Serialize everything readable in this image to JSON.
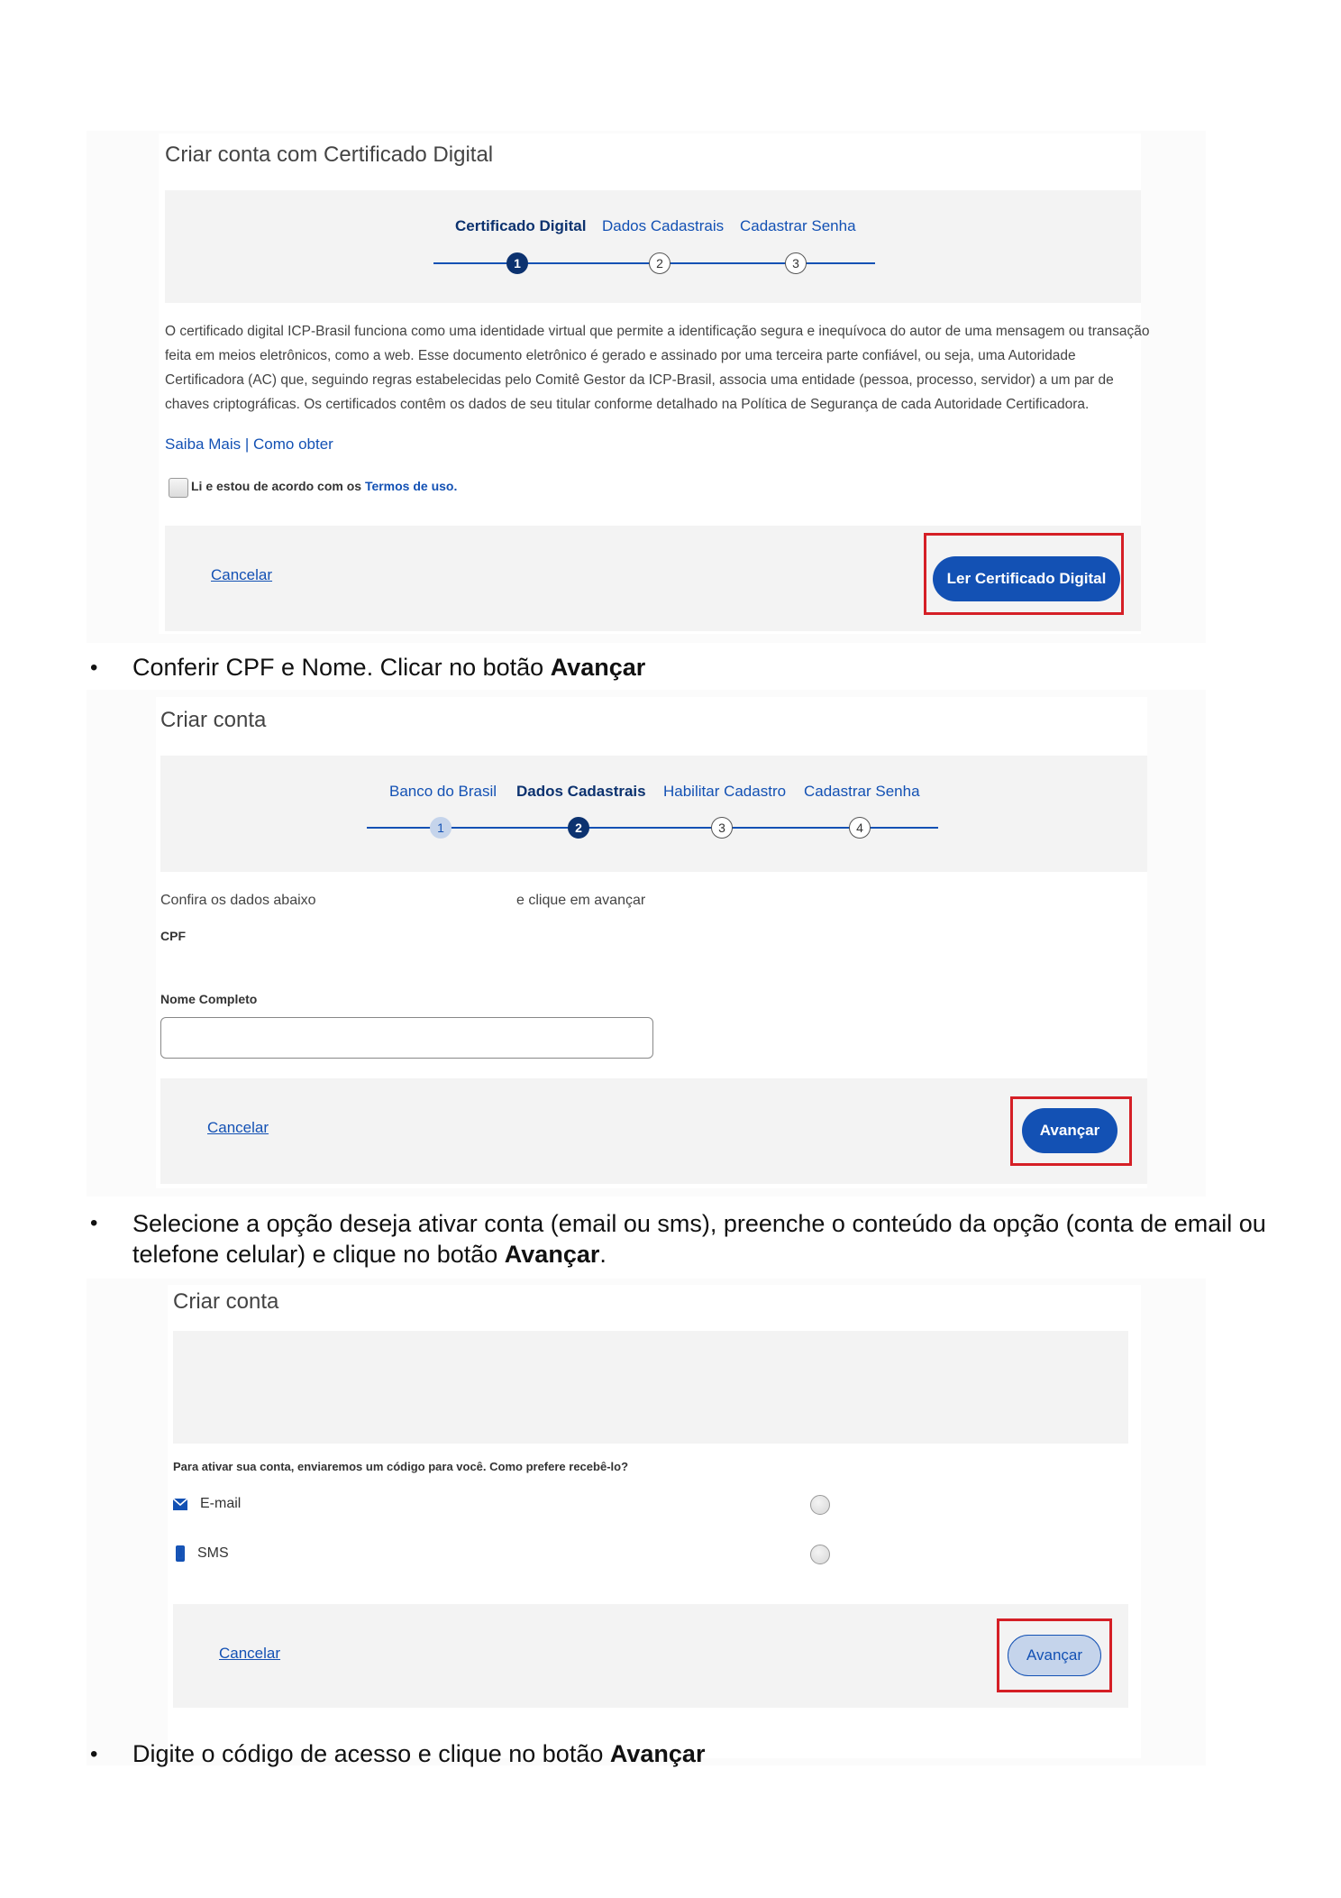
{
  "panel1": {
    "title": "Criar conta com Certificado Digital",
    "steps": [
      {
        "label": "Certificado Digital",
        "number": "1"
      },
      {
        "label": "Dados Cadastrais",
        "number": "2"
      },
      {
        "label": "Cadastrar Senha",
        "number": "3"
      }
    ],
    "paragraph_lines": [
      "O certificado digital ICP-Brasil funciona como uma identidade virtual que permite a identificação segura e inequívoca do autor de uma mensagem ou transação",
      "feita em meios eletrônicos, como a web. Esse documento eletrônico é gerado e assinado por uma terceira parte confiável, ou seja, uma Autoridade",
      "Certificadora (AC) que, seguindo regras estabelecidas pelo Comitê Gestor da ICP-Brasil, associa uma entidade (pessoa, processo, servidor) a um par de",
      "chaves criptográficas. Os certificados contêm os dados de seu titular conforme detalhado na Política de Segurança de cada Autoridade Certificadora."
    ],
    "saiba_mais": "Saiba Mais",
    "separator": "|",
    "como_obter": "Como obter",
    "terms_prefix": "Li e estou de acordo com os",
    "terms_link": "Termos de uso.",
    "cancel": "Cancelar",
    "primary_button": "Ler Certificado Digital"
  },
  "bullet1": {
    "text": "Conferir CPF e Nome. Clicar no botão",
    "bold": "Avançar"
  },
  "panel2": {
    "title": "Criar conta",
    "steps": [
      {
        "label": "Banco do Brasil",
        "number": "1"
      },
      {
        "label": "Dados Cadastrais",
        "number": "2"
      },
      {
        "label": "Habilitar Cadastro",
        "number": "3"
      },
      {
        "label": "Cadastrar Senha",
        "number": "4"
      }
    ],
    "confirm_text_left": "Confira os dados abaixo",
    "confirm_text_right": "e clique em avançar",
    "cpf_label": "CPF",
    "name_label": "Nome Completo",
    "name_value": "",
    "cancel": "Cancelar",
    "primary_button": "Avançar"
  },
  "bullet2": {
    "line1": "Selecione a opção deseja ativar conta (email ou sms), preenche o conteúdo da opção (conta de email ou",
    "line2_prefix": "telefone celular) e clique no botão",
    "bold": "Avançar",
    "suffix": "."
  },
  "panel3": {
    "title": "Criar conta",
    "question": "Para ativar sua conta, enviaremos um código para você. Como prefere recebê-lo?",
    "options": [
      {
        "label": "E-mail",
        "icon": "envelope-icon"
      },
      {
        "label": "SMS",
        "icon": "mobile-phone-icon"
      }
    ],
    "cancel": "Cancelar",
    "primary_button": "Avançar"
  },
  "bullet3": {
    "text": "Digite o código de acesso e clique no botão",
    "bold": "Avançar"
  },
  "colors": {
    "primary": "#1351b4",
    "dark_primary": "#0c326f",
    "highlight": "#d51f26"
  }
}
